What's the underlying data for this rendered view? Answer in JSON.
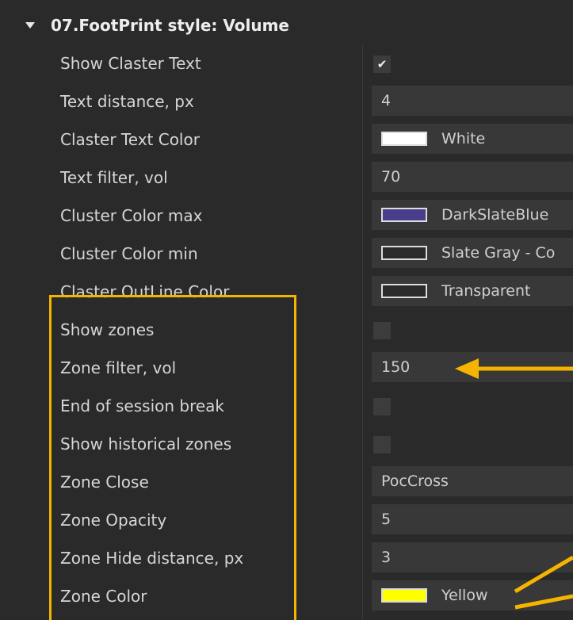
{
  "section": {
    "title": "07.FootPrint style: Volume"
  },
  "rows": [
    {
      "label": "Show Claster Text",
      "control": "checkbox",
      "checked": true,
      "check_glyph": "✔"
    },
    {
      "label": "Text distance, px",
      "control": "text",
      "value": "4"
    },
    {
      "label": "Claster Text Color",
      "control": "color",
      "value": "White",
      "swatch": "#ffffff"
    },
    {
      "label": "Text filter, vol",
      "control": "text",
      "value": "70"
    },
    {
      "label": "Cluster Color max",
      "control": "color",
      "value": "DarkSlateBlue",
      "swatch": "#483d8b"
    },
    {
      "label": "Cluster Color min",
      "control": "color",
      "value": "Slate Gray - Co",
      "swatch": "#2a2a2a"
    },
    {
      "label": "Claster OutLine Color",
      "control": "color",
      "value": "Transparent",
      "swatch": "#2a2a2a"
    },
    {
      "label": "Show zones",
      "control": "checkbox",
      "checked": false,
      "check_glyph": ""
    },
    {
      "label": "Zone filter, vol",
      "control": "text",
      "value": "150"
    },
    {
      "label": "End of session break",
      "control": "checkbox",
      "checked": false,
      "check_glyph": ""
    },
    {
      "label": "Show historical zones",
      "control": "checkbox",
      "checked": false,
      "check_glyph": ""
    },
    {
      "label": "Zone Close",
      "control": "text",
      "value": "PocCross"
    },
    {
      "label": "Zone Opacity",
      "control": "text",
      "value": "5"
    },
    {
      "label": "Zone Hide distance, px",
      "control": "text",
      "value": "3"
    },
    {
      "label": "Zone Color",
      "control": "color",
      "value": "Yellow",
      "swatch": "#ffff00"
    }
  ],
  "colors": {
    "background": "#2a2a2a",
    "field": "#383838",
    "annotation": "#f5b400"
  },
  "icons": {
    "section_caret": "caret-down-icon",
    "annotation_arrows": "arrow-left-icon"
  }
}
